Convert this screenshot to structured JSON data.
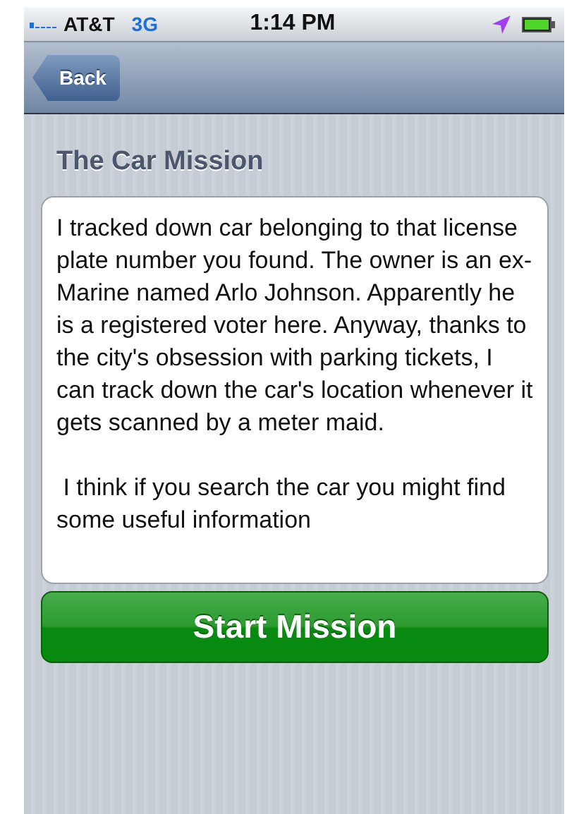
{
  "status_bar": {
    "carrier": "AT&T",
    "network": "3G",
    "time": "1:14 PM"
  },
  "nav_bar": {
    "back_button": "Back"
  },
  "title": "The Car Mission",
  "message": "I tracked down car belonging to that license plate number you found. The owner is an ex-Marine named Arlo Johnson. Apparently he is a registered voter here. Anyway, thanks to the city's obsession with parking tickets, I can track down the car's location whenever it gets scanned by a meter maid.\n\n I think if you search the car you might find some useful information",
  "button": "Start Mission"
}
